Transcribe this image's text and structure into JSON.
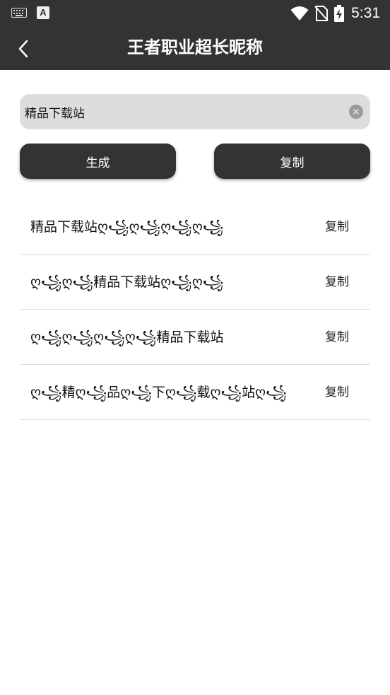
{
  "status_bar": {
    "time": "5:31",
    "icons": [
      "keyboard-icon",
      "a-app-icon",
      "wifi-icon",
      "no-sim-icon",
      "battery-charging-icon"
    ],
    "app_icon_letter": "A"
  },
  "header": {
    "title": "王者职业超长昵称",
    "back_icon": "chevron-left-icon"
  },
  "input": {
    "value": "精品下载站",
    "clear_icon": "clear-icon"
  },
  "buttons": {
    "generate": "生成",
    "copy": "复制"
  },
  "results": [
    {
      "text": "精品下载站ღ꧁ღ꧁ღ꧁ღ꧁",
      "copy_label": "复制"
    },
    {
      "text": "ღ꧁ღ꧁精品下载站ღ꧁ღ꧁",
      "copy_label": "复制"
    },
    {
      "text": "ღ꧁ღ꧁ღ꧁ღ꧁精品下载站",
      "copy_label": "复制"
    },
    {
      "text": "ღ꧁精ღ꧁品ღ꧁下ღ꧁载ღ꧁站ღ꧁",
      "copy_label": "复制"
    }
  ],
  "colors": {
    "bar_background": "#333333",
    "input_background": "#dddddd",
    "caret": "#1a9c8c",
    "divider": "#dddddd"
  }
}
